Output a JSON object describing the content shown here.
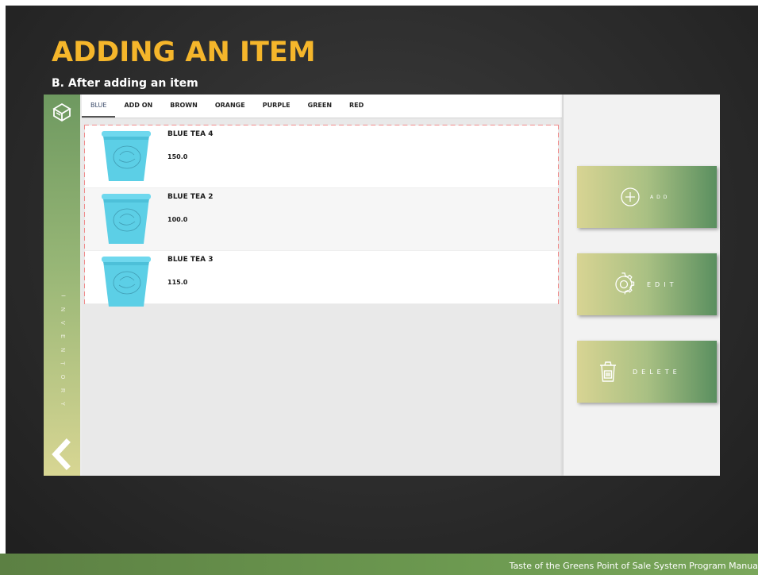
{
  "slide": {
    "title": "ADDING AN ITEM",
    "subtitle": "B. After adding an item",
    "footer": "Taste of the Greens Point of Sale System Program Manua"
  },
  "sidebar": {
    "section_label": [
      "I",
      "N",
      "V",
      "E",
      "N",
      "T",
      "O",
      "R",
      "Y"
    ],
    "icon": "box-icon",
    "back_icon": "chevron-left-icon"
  },
  "tabs": [
    "BLUE",
    "ADD ON",
    "BROWN",
    "ORANGE",
    "PURPLE",
    "GREEN",
    "RED"
  ],
  "active_tab": "BLUE",
  "items": [
    {
      "name": "BLUE TEA 4",
      "price": "150.0"
    },
    {
      "name": "BLUE TEA 2",
      "price": "100.0"
    },
    {
      "name": "BLUE TEA 3",
      "price": "115.0"
    }
  ],
  "actions": {
    "add_label": "ADD",
    "edit_label": "EDIT",
    "delete_label": "DELETE"
  },
  "colors": {
    "title": "#f5b62b",
    "cup": "#5ccfe6",
    "highlight_dash": "#f08a8a",
    "sidebar_top": "#6e9960",
    "sidebar_bottom": "#d8d693"
  }
}
